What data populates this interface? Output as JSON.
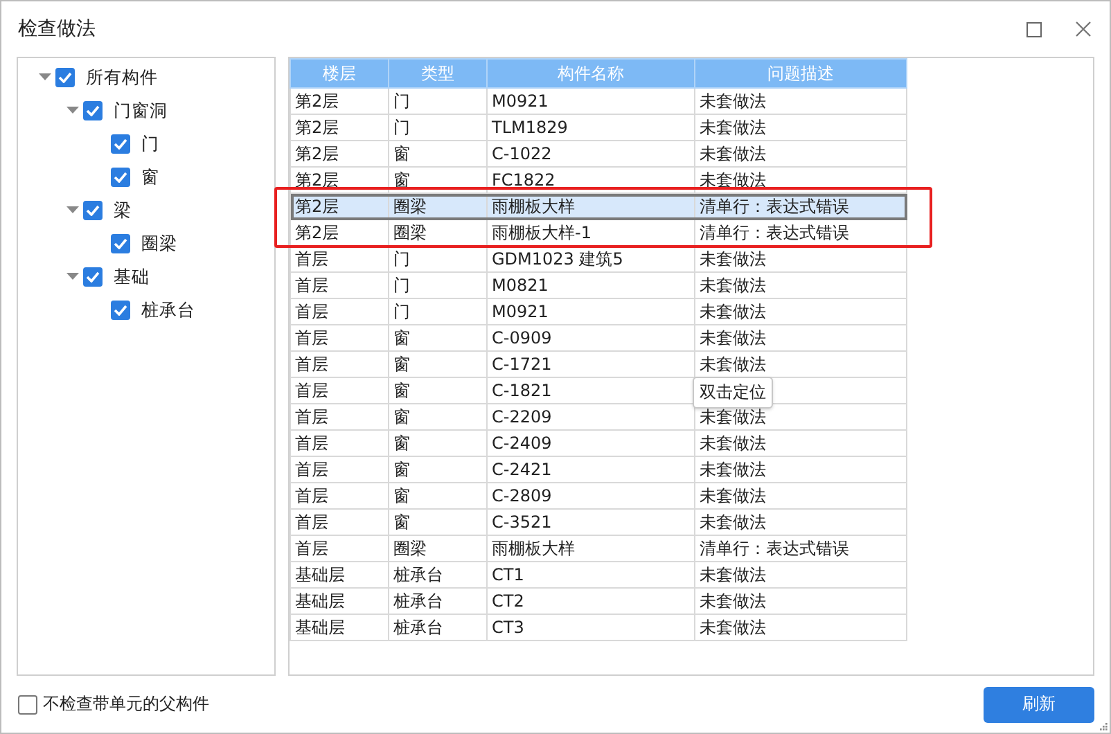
{
  "window": {
    "title": "检查做法"
  },
  "tree": [
    {
      "label": "所有构件",
      "checked": true,
      "expanded": true,
      "children": [
        {
          "label": "门窗洞",
          "checked": true,
          "expanded": true,
          "children": [
            {
              "label": "门",
              "checked": true
            },
            {
              "label": "窗",
              "checked": true
            }
          ]
        },
        {
          "label": "梁",
          "checked": true,
          "expanded": true,
          "children": [
            {
              "label": "圈梁",
              "checked": true
            }
          ]
        },
        {
          "label": "基础",
          "checked": true,
          "expanded": true,
          "children": [
            {
              "label": "桩承台",
              "checked": true
            }
          ]
        }
      ]
    }
  ],
  "table": {
    "columns": [
      "楼层",
      "类型",
      "构件名称",
      "问题描述"
    ],
    "rows": [
      {
        "cells": [
          "第2层",
          "门",
          "M0921",
          "未套做法"
        ],
        "selected": false,
        "highlighted": false
      },
      {
        "cells": [
          "第2层",
          "门",
          "TLM1829",
          "未套做法"
        ],
        "selected": false,
        "highlighted": false
      },
      {
        "cells": [
          "第2层",
          "窗",
          "C-1022",
          "未套做法"
        ],
        "selected": false,
        "highlighted": false
      },
      {
        "cells": [
          "第2层",
          "窗",
          "FC1822",
          "未套做法"
        ],
        "selected": false,
        "highlighted": false
      },
      {
        "cells": [
          "第2层",
          "圈梁",
          "雨棚板大样",
          "清单行：表达式错误"
        ],
        "selected": true,
        "highlighted": true
      },
      {
        "cells": [
          "第2层",
          "圈梁",
          "雨棚板大样-1",
          "清单行：表达式错误"
        ],
        "selected": false,
        "highlighted": true
      },
      {
        "cells": [
          "首层",
          "门",
          "GDM1023 建筑5",
          "未套做法"
        ],
        "selected": false,
        "highlighted": false
      },
      {
        "cells": [
          "首层",
          "门",
          "M0821",
          "未套做法"
        ],
        "selected": false,
        "highlighted": false
      },
      {
        "cells": [
          "首层",
          "门",
          "M0921",
          "未套做法"
        ],
        "selected": false,
        "highlighted": false
      },
      {
        "cells": [
          "首层",
          "窗",
          "C-0909",
          "未套做法"
        ],
        "selected": false,
        "highlighted": false
      },
      {
        "cells": [
          "首层",
          "窗",
          "C-1721",
          "未套做法"
        ],
        "selected": false,
        "highlighted": false
      },
      {
        "cells": [
          "首层",
          "窗",
          "C-1821",
          ""
        ],
        "selected": false,
        "highlighted": false
      },
      {
        "cells": [
          "首层",
          "窗",
          "C-2209",
          "未套做法"
        ],
        "selected": false,
        "highlighted": false
      },
      {
        "cells": [
          "首层",
          "窗",
          "C-2409",
          "未套做法"
        ],
        "selected": false,
        "highlighted": false
      },
      {
        "cells": [
          "首层",
          "窗",
          "C-2421",
          "未套做法"
        ],
        "selected": false,
        "highlighted": false
      },
      {
        "cells": [
          "首层",
          "窗",
          "C-2809",
          "未套做法"
        ],
        "selected": false,
        "highlighted": false
      },
      {
        "cells": [
          "首层",
          "窗",
          "C-3521",
          "未套做法"
        ],
        "selected": false,
        "highlighted": false
      },
      {
        "cells": [
          "首层",
          "圈梁",
          "雨棚板大样",
          "清单行：表达式错误"
        ],
        "selected": false,
        "highlighted": false
      },
      {
        "cells": [
          "基础层",
          "桩承台",
          "CT1",
          "未套做法"
        ],
        "selected": false,
        "highlighted": false
      },
      {
        "cells": [
          "基础层",
          "桩承台",
          "CT2",
          "未套做法"
        ],
        "selected": false,
        "highlighted": false
      },
      {
        "cells": [
          "基础层",
          "桩承台",
          "CT3",
          "未套做法"
        ],
        "selected": false,
        "highlighted": false
      }
    ],
    "tooltip": {
      "text": "双击定位"
    }
  },
  "footer": {
    "checkbox": {
      "label": "不检查带单元的父构件",
      "checked": false
    },
    "button": "刷新"
  }
}
